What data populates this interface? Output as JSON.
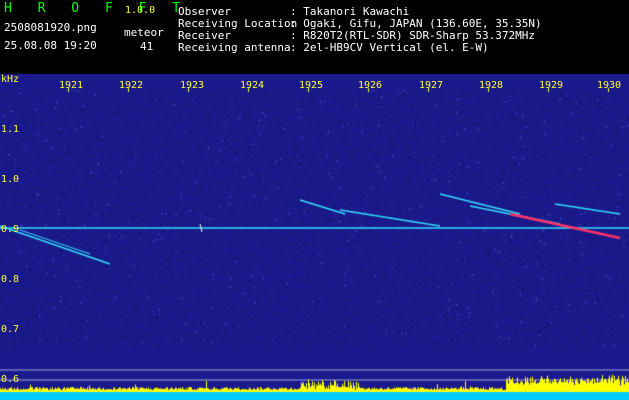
{
  "header": {
    "logo": "H R O F F T",
    "version": "1.0.0",
    "filename": "2508081920.png",
    "datetime": "25.08.08 19:20",
    "meteor_label": "meteor",
    "meteor_count": "41"
  },
  "info": [
    {
      "label": "Observer",
      "value": ": Takanori Kawachi"
    },
    {
      "label": "Receiving Location",
      "value": ": Ogaki, Gifu, JAPAN (136.60E, 35.35N)"
    },
    {
      "label": "Receiver",
      "value": ": R820T2(RTL-SDR) SDR-Sharp 53.372MHz"
    },
    {
      "label": "Receiving antenna",
      "value": ": 2el-HB9CV Vertical (el. E-W)"
    }
  ],
  "spectrogram": {
    "unit_label": "kHz",
    "time_ticks": [
      "1921",
      "1922",
      "1923",
      "1924",
      "1925",
      "1926",
      "1927",
      "1928",
      "1929",
      "1930"
    ],
    "freq_ticks": [
      "1.1",
      "1.0",
      "0.9",
      "0.8",
      "0.7",
      "0.6"
    ],
    "colors": {
      "background": "#1a1a8c",
      "trace": "#33ddff",
      "strong": "#ff3366",
      "histogram": "#ffff00",
      "baseline": "#00ccff"
    }
  }
}
